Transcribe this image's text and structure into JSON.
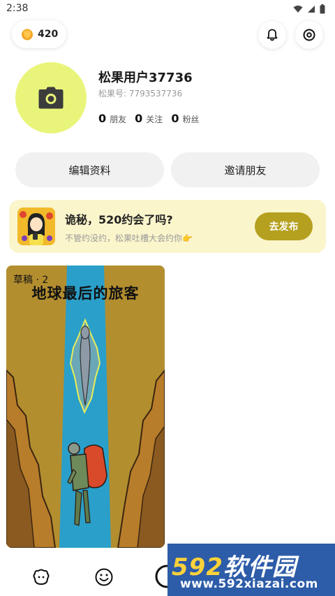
{
  "status_bar": {
    "time": "2:38",
    "icons": [
      "wifi-icon",
      "signal-icon",
      "battery-icon"
    ]
  },
  "header": {
    "coin_count": "420",
    "icons": [
      "coin-icon",
      "bell-icon",
      "settings-icon"
    ]
  },
  "profile": {
    "username": "松果用户37736",
    "user_id": "松果号: 7793537736",
    "stats": [
      {
        "num": "0",
        "label": "朋友"
      },
      {
        "num": "0",
        "label": "关注"
      },
      {
        "num": "0",
        "label": "粉丝"
      }
    ],
    "avatar_icon": "camera-icon"
  },
  "actions": {
    "edit_label": "编辑资料",
    "invite_label": "邀请朋友"
  },
  "banner": {
    "title": "诡秘，520约会了吗?",
    "subtitle": "不管约没约，松果吐槽大会约你👉",
    "button_label": "去发布"
  },
  "draft": {
    "label": "草稿 · 2",
    "title": "地球最后的旅客"
  },
  "tab_bar": {
    "icons": [
      "home-face-icon",
      "smile-icon",
      "publish-icon"
    ]
  },
  "watermark": {
    "logo_num": "592",
    "logo_text": "软件园",
    "url": "www.592xiazai.com"
  },
  "colors": {
    "avatar_bg": "#e9f57a",
    "banner_bg": "#fbf5cc",
    "banner_button": "#b5a01f",
    "watermark_bg": "#2d5ca8"
  }
}
